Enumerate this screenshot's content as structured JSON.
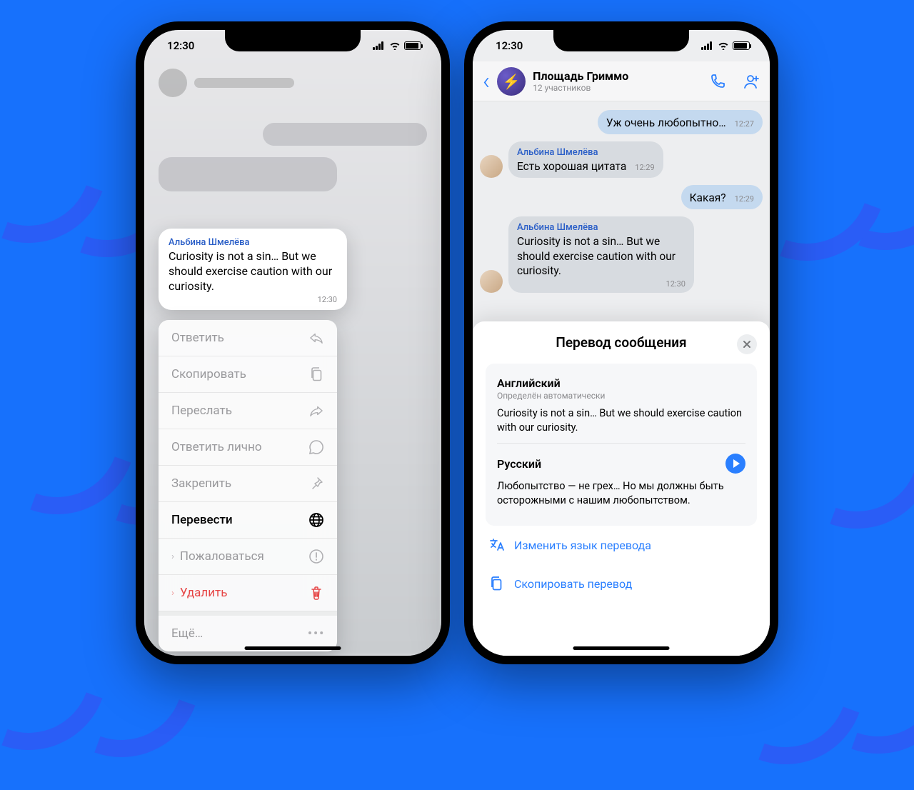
{
  "status": {
    "time": "12:30"
  },
  "left": {
    "message": {
      "sender": "Альбина Шмелёва",
      "text": "Curiosity is not a sin… But we should exercise caution with our curiosity.",
      "time": "12:30"
    },
    "menu": {
      "reply": "Ответить",
      "copy": "Скопировать",
      "forward": "Переслать",
      "reply_privately": "Ответить лично",
      "pin": "Закрепить",
      "translate": "Перевести",
      "report": "Пожаловаться",
      "delete": "Удалить",
      "more": "Ещё…"
    }
  },
  "right": {
    "header": {
      "title": "Площадь Гриммо",
      "subtitle": "12 участников"
    },
    "messages": {
      "m1": {
        "text": "Уж очень любопытно…",
        "time": "12:27"
      },
      "m2": {
        "sender": "Альбина Шмелёва",
        "text": "Есть хорошая цитата",
        "time": "12:29"
      },
      "m3": {
        "text": "Какая?",
        "time": "12:29"
      },
      "m4": {
        "sender": "Альбина Шмелёва",
        "text": "Curiosity is not a sin… But we should exercise caution with our curiosity.",
        "time": "12:30"
      }
    },
    "sheet": {
      "title": "Перевод сообщения",
      "source": {
        "lang": "Английский",
        "sub": "Определён автоматически",
        "text": "Curiosity is not a sin… But we should exercise caution with our curiosity."
      },
      "target": {
        "lang": "Русский",
        "text": "Любопытство — не грех… Но мы должны быть осторожными с нашим любопытством."
      },
      "change_language": "Изменить язык перевода",
      "copy_translation": "Скопировать перевод"
    }
  }
}
